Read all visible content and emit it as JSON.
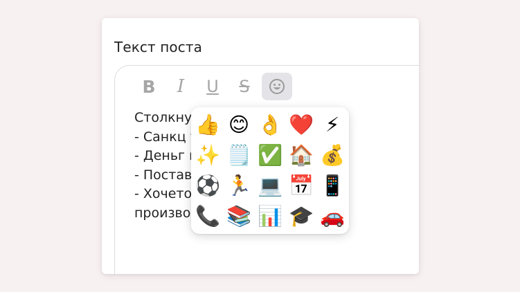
{
  "form": {
    "label": "Текст поста"
  },
  "toolbar": {
    "bold": "B",
    "italic": "I",
    "underline": "U",
    "strike": "S",
    "emoji_icon": "emoji-smile-icon"
  },
  "editor": {
    "lines": [
      "Столкну",
      "- Санкц                        у и доход",
      "- Деньг                        вщиков;",
      "- Постав                        принимат",
      "- Хочето                        родный р",
      "производить оплату?"
    ]
  },
  "emoji_picker": {
    "emojis": [
      {
        "char": "👍",
        "name": "thumbs-up-icon"
      },
      {
        "char": "😊",
        "name": "smiling-face-icon"
      },
      {
        "char": "👌",
        "name": "ok-hand-icon"
      },
      {
        "char": "❤️",
        "name": "red-heart-icon"
      },
      {
        "char": "⚡",
        "name": "lightning-icon"
      },
      {
        "char": "✨",
        "name": "sparkles-icon"
      },
      {
        "char": "🗒️",
        "name": "notepad-icon"
      },
      {
        "char": "✅",
        "name": "check-box-icon"
      },
      {
        "char": "🏠",
        "name": "house-icon"
      },
      {
        "char": "💰",
        "name": "money-bag-icon"
      },
      {
        "char": "⚽",
        "name": "soccer-ball-icon"
      },
      {
        "char": "🏃",
        "name": "runner-icon"
      },
      {
        "char": "💻",
        "name": "laptop-icon"
      },
      {
        "char": "📅",
        "name": "calendar-icon"
      },
      {
        "char": "📱",
        "name": "mobile-phone-icon"
      },
      {
        "char": "📞",
        "name": "telephone-icon"
      },
      {
        "char": "📚",
        "name": "books-icon"
      },
      {
        "char": "📊",
        "name": "bar-chart-icon"
      },
      {
        "char": "🎓",
        "name": "graduation-cap-icon"
      },
      {
        "char": "🚗",
        "name": "car-icon"
      }
    ]
  },
  "colors": {
    "background": "#f8f1f1",
    "card": "#ffffff",
    "toolbar_icon": "#a6a6a6",
    "active_button_bg": "#e4e4e8",
    "text": "#222222"
  }
}
